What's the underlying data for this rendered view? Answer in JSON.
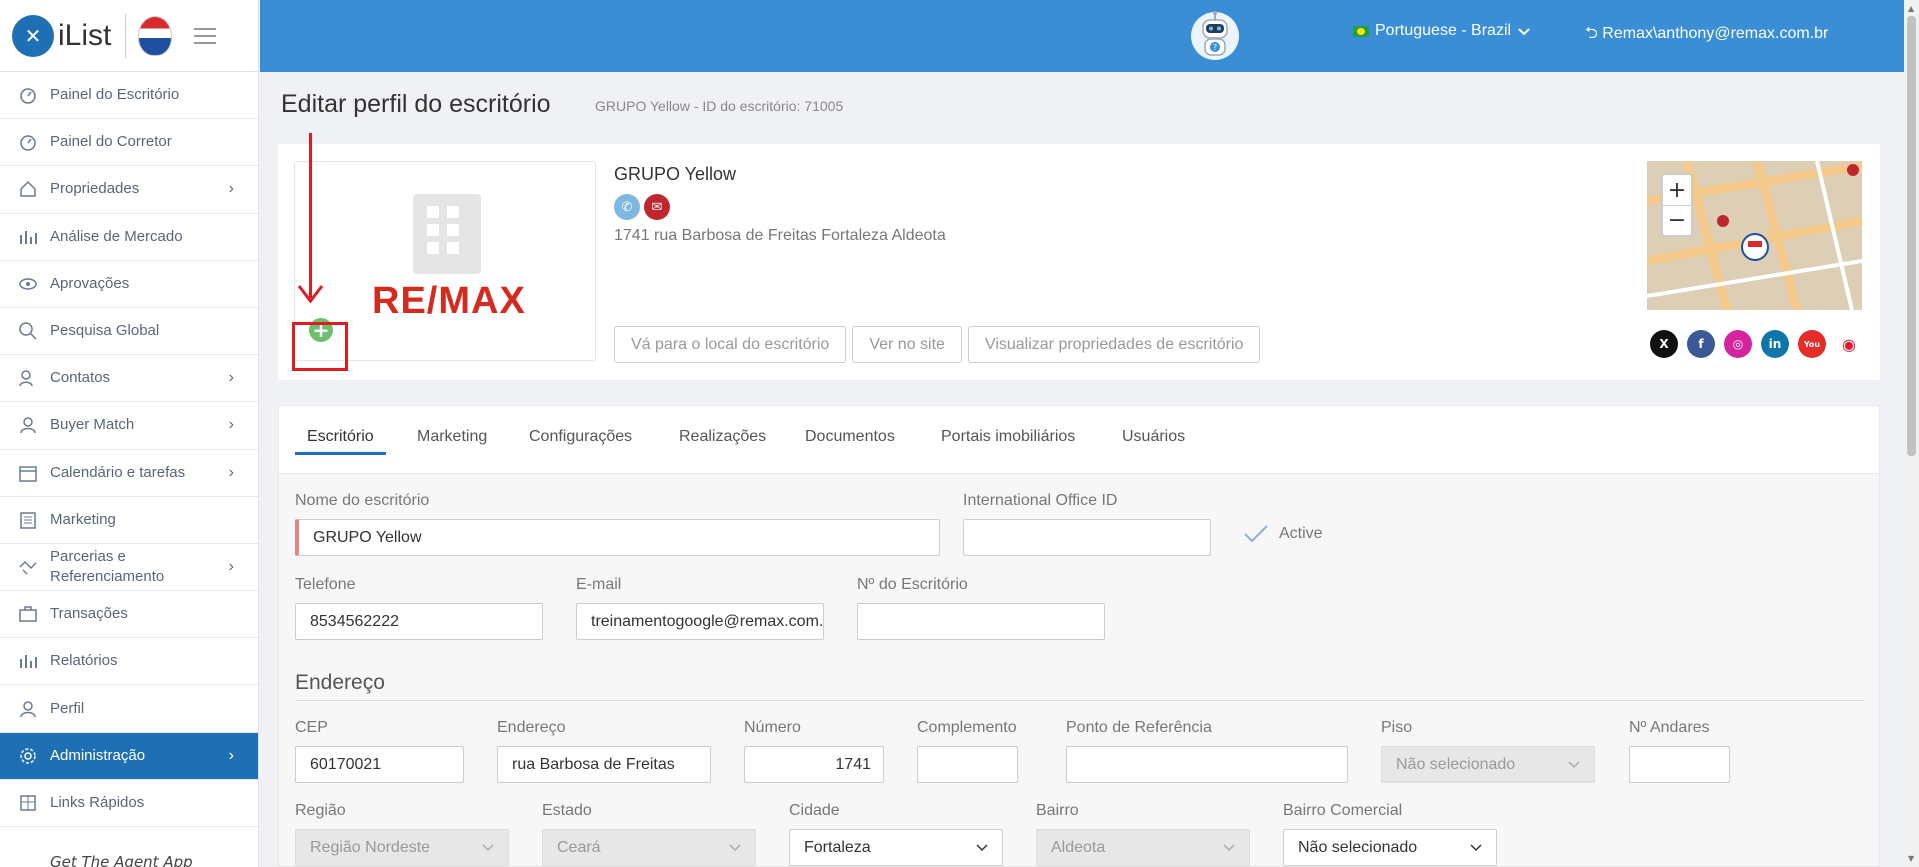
{
  "sidebar": {
    "brand": "iList",
    "items": [
      {
        "label": "Painel do Escritório",
        "icon": "gauge-icon",
        "chevron": false
      },
      {
        "label": "Painel do Corretor",
        "icon": "gauge-icon",
        "chevron": false
      },
      {
        "label": "Propriedades",
        "icon": "home-icon",
        "chevron": true
      },
      {
        "label": "Análise de Mercado",
        "icon": "bar-chart-icon",
        "chevron": false
      },
      {
        "label": "Aprovações",
        "icon": "eye-icon",
        "chevron": false
      },
      {
        "label": "Pesquisa Global",
        "icon": "search-icon",
        "chevron": false
      },
      {
        "label": "Contatos",
        "icon": "contacts-icon",
        "chevron": true
      },
      {
        "label": "Buyer Match",
        "icon": "user-icon",
        "chevron": true
      },
      {
        "label": "Calendário e tarefas",
        "icon": "calendar-icon",
        "chevron": true
      },
      {
        "label": "Marketing",
        "icon": "book-icon",
        "chevron": false
      },
      {
        "label": "Parcerias e Referenciamento",
        "icon": "handshake-icon",
        "chevron": true
      },
      {
        "label": "Transações",
        "icon": "briefcase-icon",
        "chevron": false
      },
      {
        "label": "Relatórios",
        "icon": "bar-chart-icon",
        "chevron": false
      },
      {
        "label": "Perfil",
        "icon": "user-icon",
        "chevron": false
      },
      {
        "label": "Administração",
        "icon": "gear-icon",
        "chevron": true,
        "active": true
      },
      {
        "label": "Links Rápidos",
        "icon": "links-icon",
        "chevron": false
      }
    ],
    "footer": "Get The Agent App"
  },
  "topbar": {
    "language": "Portuguese - Brazil",
    "user": "Remax\\anthony@remax.com.br"
  },
  "page": {
    "title": "Editar perfil do escritório",
    "subtitle": "GRUPO Yellow - ID do escritório: 71005"
  },
  "office": {
    "name": "GRUPO Yellow",
    "address": "1741 rua Barbosa de Freitas Fortaleza Aldeota",
    "logo_text": "RE/MAX",
    "buttons": [
      "Vá para o local do escritório",
      "Ver no site",
      "Visualizar propriedades de escritório"
    ],
    "map_zoom_in": "+",
    "map_zoom_out": "−",
    "social": [
      "x-icon",
      "facebook-icon",
      "instagram-icon",
      "linkedin-icon",
      "youtube-icon",
      "weibo-icon"
    ]
  },
  "tabs": [
    "Escritório",
    "Marketing",
    "Configurações",
    "Realizações",
    "Documentos",
    "Portais imobiliários",
    "Usuários"
  ],
  "form": {
    "office_name_label": "Nome do escritório",
    "office_name_value": "GRUPO Yellow",
    "intl_id_label": "International Office ID",
    "intl_id_value": "",
    "active_label": "Active",
    "phone_label": "Telefone",
    "phone_value": "8534562222",
    "email_label": "E-mail",
    "email_value": "treinamentogoogle@remax.com.br",
    "office_no_label": "Nº do Escritório",
    "office_no_value": "",
    "address_section": "Endereço",
    "cep_label": "CEP",
    "cep_value": "60170021",
    "street_label": "Endereço",
    "street_value": "rua Barbosa de Freitas",
    "number_label": "Número",
    "number_value": "1741",
    "complement_label": "Complemento",
    "reference_label": "Ponto de Referência",
    "floor_label": "Piso",
    "floor_value": "Não selecionado",
    "floors_label": "Nº Andares",
    "region_label": "Região",
    "region_value": "Região Nordeste",
    "state_label": "Estado",
    "state_value": "Ceará",
    "city_label": "Cidade",
    "city_value": "Fortaleza",
    "district_label": "Bairro",
    "district_value": "Aldeota",
    "comm_district_label": "Bairro Comercial",
    "comm_district_value": "Não selecionado"
  },
  "colors": {
    "primary": "#1f6fb5",
    "topbar": "#3a8ed6",
    "annotation": "#e11b22",
    "remax_red": "#d52b1e"
  }
}
